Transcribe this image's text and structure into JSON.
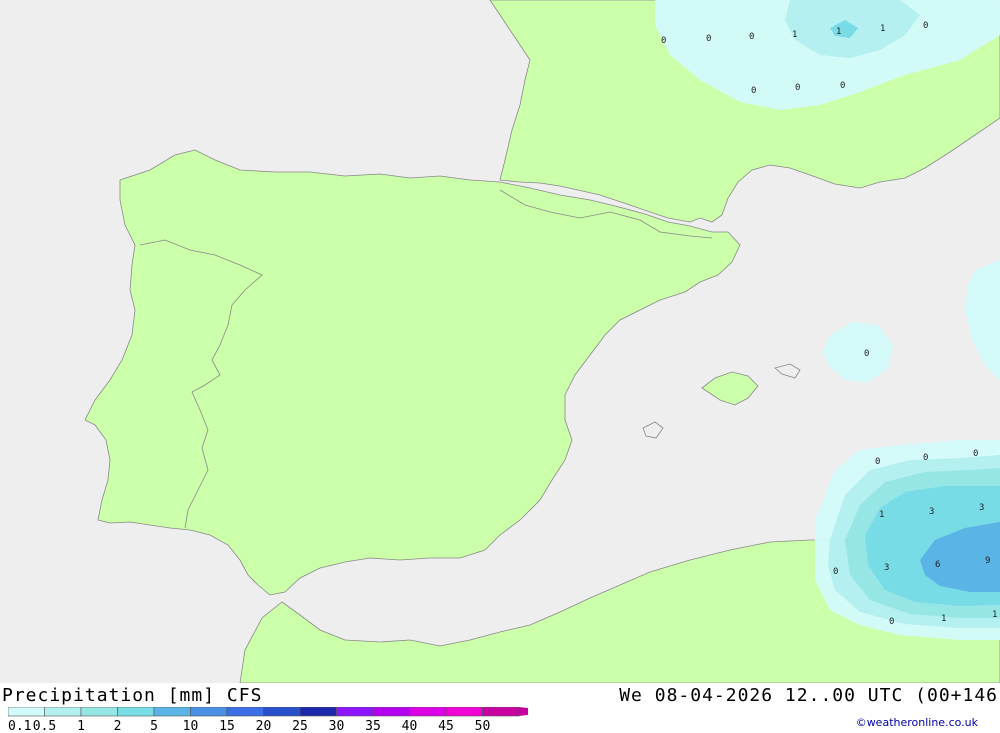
{
  "title": "Precipitation [mm] CFS",
  "datetime": "We 08-04-2026 12..00 UTC (00+146",
  "credit": "©weatheronline.co.uk",
  "legend": {
    "labels": [
      "0.1",
      "0.5",
      "1",
      "2",
      "5",
      "10",
      "15",
      "20",
      "25",
      "30",
      "35",
      "40",
      "45",
      "50"
    ],
    "colors": [
      "#d2fafa",
      "#b4f0f0",
      "#96e6e6",
      "#78dce6",
      "#5ab4e6",
      "#4a90e6",
      "#3c6ee6",
      "#2850c8",
      "#1e28aa",
      "#8c14ff",
      "#b400f0",
      "#dc00e6",
      "#f000d2",
      "#c800a0"
    ]
  },
  "colors": {
    "sea": "#eeeeee",
    "land": "#ccffaa",
    "border": "#888888"
  },
  "map_values": [
    {
      "id": "v1",
      "text": "0"
    },
    {
      "id": "v2",
      "text": "0"
    },
    {
      "id": "v3",
      "text": "0"
    },
    {
      "id": "v4",
      "text": "1"
    },
    {
      "id": "v5",
      "text": "1"
    },
    {
      "id": "v6",
      "text": "1"
    },
    {
      "id": "v7",
      "text": "0"
    },
    {
      "id": "v8",
      "text": "0"
    },
    {
      "id": "v9",
      "text": "0"
    },
    {
      "id": "v10",
      "text": "0"
    },
    {
      "id": "v11",
      "text": "0"
    },
    {
      "id": "v12",
      "text": "0"
    },
    {
      "id": "v13",
      "text": "0"
    },
    {
      "id": "v14",
      "text": "0"
    },
    {
      "id": "v15",
      "text": "1"
    },
    {
      "id": "v16",
      "text": "3"
    },
    {
      "id": "v17",
      "text": "3"
    },
    {
      "id": "v18",
      "text": "0"
    },
    {
      "id": "v19",
      "text": "3"
    },
    {
      "id": "v20",
      "text": "6"
    },
    {
      "id": "v21",
      "text": "9"
    },
    {
      "id": "v22",
      "text": "0"
    },
    {
      "id": "v23",
      "text": "1"
    },
    {
      "id": "v24",
      "text": "1"
    }
  ]
}
